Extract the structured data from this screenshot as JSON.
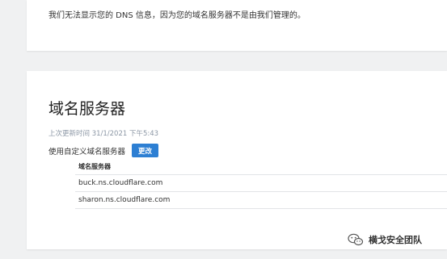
{
  "dns_notice": {
    "text": "我们无法显示您的 DNS 信息，因为您的域名服务器不是由我们管理的。"
  },
  "nameservers": {
    "title": "域名服务器",
    "last_updated": "上次更新时间 31/1/2021 下午5:43",
    "custom_label": "使用自定义域名服务器",
    "change_button": "更改",
    "table_header": "域名服务器",
    "rows": [
      "buck.ns.cloudflare.com",
      "sharon.ns.cloudflare.com"
    ]
  },
  "watermark": {
    "icon": "wechat-icon",
    "text": "横戈安全团队"
  }
}
